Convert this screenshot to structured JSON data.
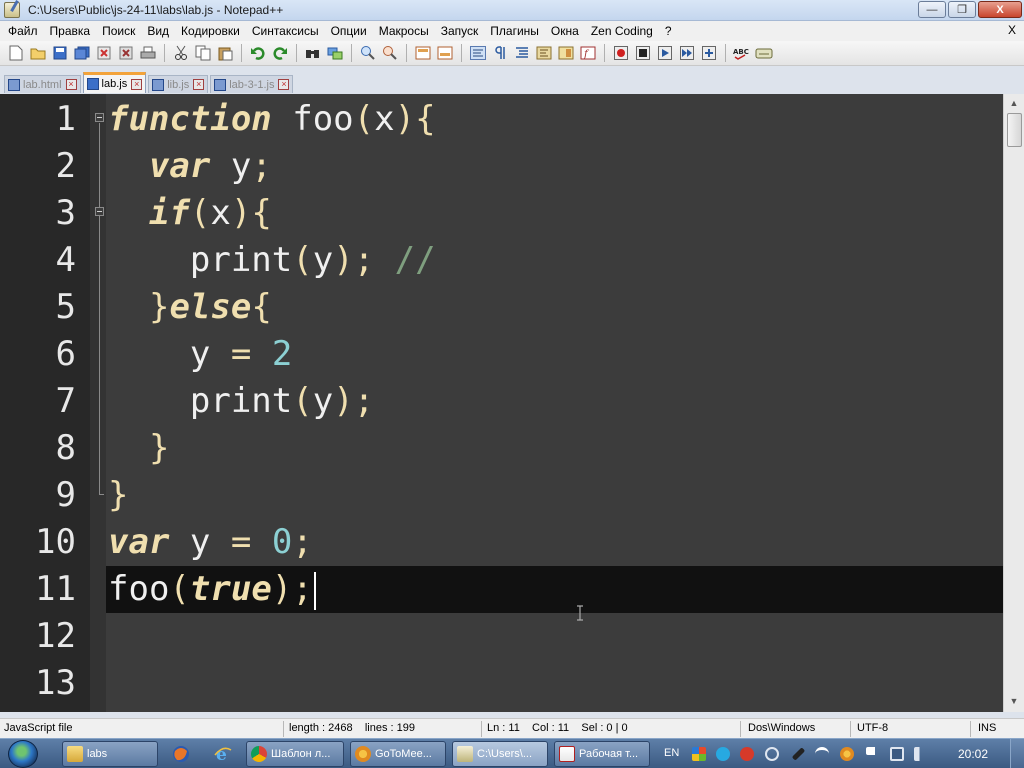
{
  "window": {
    "title": "C:\\Users\\Public\\js-24-11\\labs\\lab.js - Notepad++",
    "minimize_glyph": "—",
    "maximize_glyph": "❐",
    "close_glyph": "X"
  },
  "menu": {
    "items": [
      "Файл",
      "Правка",
      "Поиск",
      "Вид",
      "Кодировки",
      "Синтаксисы",
      "Опции",
      "Макросы",
      "Запуск",
      "Плагины",
      "Окна",
      "Zen Coding",
      "?"
    ],
    "close_label": "X"
  },
  "toolbar": {
    "icons": [
      "new-file-icon",
      "open-file-icon",
      "save-icon",
      "save-all-icon",
      "close-icon",
      "close-all-icon",
      "print-icon",
      "cut-icon",
      "copy-icon",
      "paste-icon",
      "undo-icon",
      "redo-icon",
      "find-icon",
      "replace-icon",
      "zoom-in-icon",
      "zoom-out-icon",
      "sync-vertical-icon",
      "sync-horizontal-icon",
      "word-wrap-icon",
      "all-chars-icon",
      "indent-guide-icon",
      "user-lang-icon",
      "doc-map-icon",
      "function-list-icon",
      "record-macro-icon",
      "stop-macro-icon",
      "play-macro-icon",
      "run-macro-multiple-icon",
      "save-macro-icon",
      "spell-check-icon",
      "spell-check-auto-icon"
    ]
  },
  "tabs": [
    {
      "label": "lab.html",
      "active": false
    },
    {
      "label": "lab.js",
      "active": true
    },
    {
      "label": "lib.js",
      "active": false
    },
    {
      "label": "lab-3-1.js",
      "active": false
    }
  ],
  "editor": {
    "line_numbers": [
      "1",
      "2",
      "3",
      "4",
      "5",
      "6",
      "7",
      "8",
      "9",
      "10",
      "11",
      "12",
      "13"
    ],
    "lines": [
      {
        "indent": "",
        "tokens": [
          [
            "kw",
            "function"
          ],
          [
            "t",
            " foo"
          ],
          [
            "b",
            "("
          ],
          [
            "t",
            "x"
          ],
          [
            "b",
            "){"
          ]
        ]
      },
      {
        "indent": "  ",
        "tokens": [
          [
            "kw",
            "var"
          ],
          [
            "t",
            " y"
          ],
          [
            "b",
            ";"
          ]
        ]
      },
      {
        "indent": "  ",
        "tokens": [
          [
            "kw",
            "if"
          ],
          [
            "b",
            "("
          ],
          [
            "t",
            "x"
          ],
          [
            "b",
            "){"
          ]
        ]
      },
      {
        "indent": "    ",
        "tokens": [
          [
            "t",
            "print"
          ],
          [
            "b",
            "("
          ],
          [
            "t",
            "y"
          ],
          [
            "b",
            ");"
          ],
          [
            "t",
            " "
          ],
          [
            "c",
            "//"
          ]
        ]
      },
      {
        "indent": "  ",
        "tokens": [
          [
            "b",
            "}"
          ],
          [
            "kw",
            "else"
          ],
          [
            "b",
            "{"
          ]
        ]
      },
      {
        "indent": "    ",
        "tokens": [
          [
            "t",
            "y "
          ],
          [
            "b",
            "="
          ],
          [
            "t",
            " "
          ],
          [
            "n",
            "2"
          ]
        ]
      },
      {
        "indent": "    ",
        "tokens": [
          [
            "t",
            "print"
          ],
          [
            "b",
            "("
          ],
          [
            "t",
            "y"
          ],
          [
            "b",
            ");"
          ]
        ]
      },
      {
        "indent": "  ",
        "tokens": [
          [
            "b",
            "}"
          ]
        ]
      },
      {
        "indent": "",
        "tokens": [
          [
            "b",
            "}"
          ]
        ]
      },
      {
        "indent": "",
        "tokens": [
          [
            "kw",
            "var"
          ],
          [
            "t",
            " y "
          ],
          [
            "b",
            "="
          ],
          [
            "t",
            " "
          ],
          [
            "n",
            "0"
          ],
          [
            "b",
            ";"
          ]
        ]
      },
      {
        "indent": "",
        "tokens": [
          [
            "t",
            "foo"
          ],
          [
            "b",
            "("
          ],
          [
            "kw",
            "true"
          ],
          [
            "b",
            ");"
          ]
        ]
      },
      {
        "indent": "",
        "tokens": []
      },
      {
        "indent": "",
        "tokens": []
      }
    ],
    "current_line": 11,
    "colors": {
      "background": "#3c3c3c",
      "gutter": "#282828",
      "current_line": "#111111",
      "keyword": "#f0dfaf",
      "number": "#8cd0d3",
      "comment": "#7f9f7f",
      "text": "#f0f0f0"
    }
  },
  "status": {
    "language": "JavaScript file",
    "length": "length : 2468    lines : 199",
    "position": "Ln : 11    Col : 11    Sel : 0 | 0",
    "eol": "Dos\\Windows",
    "encoding": "UTF-8",
    "mode": "INS"
  },
  "taskbar": {
    "buttons": [
      {
        "label": "labs",
        "icon": "folder-icon",
        "active": false
      },
      {
        "label": "Шаблон л...",
        "icon": "chrome-icon",
        "active": false
      },
      {
        "label": "GoToMee...",
        "icon": "gotomeeting-icon",
        "active": false
      },
      {
        "label": "C:\\Users\\...",
        "icon": "notepadpp-icon",
        "active": true
      },
      {
        "label": "Рабочая т...",
        "icon": "pdf-icon",
        "active": false
      }
    ],
    "pinned": [
      "firefox-icon",
      "ie-icon"
    ],
    "language": "EN",
    "tray_icons": [
      "win-flag-icon",
      "skype-icon",
      "antivirus-icon",
      "link-icon",
      "tool-icon",
      "network-wifi-icon",
      "flower-icon",
      "flag-icon",
      "monitor-icon",
      "volume-icon"
    ],
    "clock": "20:02"
  }
}
